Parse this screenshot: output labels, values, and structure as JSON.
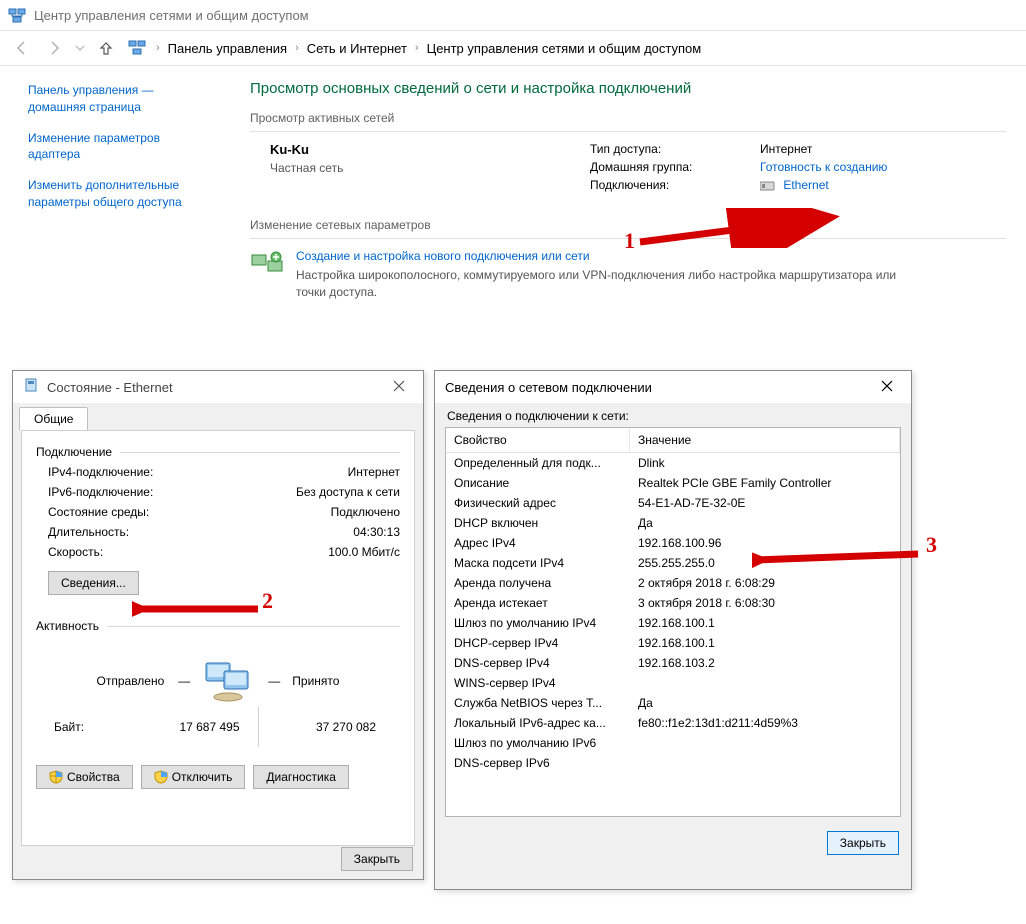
{
  "window_title": "Центр управления сетями и общим доступом",
  "breadcrumb": {
    "items": [
      "Панель управления",
      "Сеть и Интернет",
      "Центр управления сетями и общим доступом"
    ]
  },
  "left_links": [
    "Панель управления — домашняя страница",
    "Изменение параметров адаптера",
    "Изменить дополнительные параметры общего доступа"
  ],
  "page_heading": "Просмотр основных сведений о сети и настройка подключений",
  "section_active_nets": "Просмотр активных сетей",
  "net": {
    "name": "Ku-Ku",
    "type": "Частная сеть",
    "access_label": "Тип доступа:",
    "access_value": "Интернет",
    "homegroup_label": "Домашняя группа:",
    "homegroup_value": "Готовность к созданию",
    "connections_label": "Подключения:",
    "connections_value": "Ethernet"
  },
  "section_change": "Изменение сетевых параметров",
  "setup": {
    "link": "Создание и настройка нового подключения или сети",
    "desc": "Настройка широкополосного, коммутируемого или VPN-подключения либо настройка маршрутизатора или точки доступа."
  },
  "status_dialog": {
    "title": "Состояние - Ethernet",
    "tab": "Общие",
    "group_conn": "Подключение",
    "rows": [
      {
        "k": "IPv4-подключение:",
        "v": "Интернет"
      },
      {
        "k": "IPv6-подключение:",
        "v": "Без доступа к сети"
      },
      {
        "k": "Состояние среды:",
        "v": "Подключено"
      },
      {
        "k": "Длительность:",
        "v": "04:30:13"
      },
      {
        "k": "Скорость:",
        "v": "100.0 Мбит/с"
      }
    ],
    "details_btn": "Сведения...",
    "group_activity": "Активность",
    "sent_label": "Отправлено",
    "recv_label": "Принято",
    "bytes_label": "Байт:",
    "sent_bytes": "17 687 495",
    "recv_bytes": "37 270 082",
    "props_btn": "Свойства",
    "disable_btn": "Отключить",
    "diag_btn": "Диагностика",
    "close_btn": "Закрыть"
  },
  "details_dialog": {
    "title": "Сведения о сетевом подключении",
    "list_label": "Сведения о подключении к сети:",
    "col_prop": "Свойство",
    "col_val": "Значение",
    "rows": [
      {
        "k": "Определенный для подк...",
        "v": "Dlink"
      },
      {
        "k": "Описание",
        "v": "Realtek PCIe GBE Family Controller"
      },
      {
        "k": "Физический адрес",
        "v": "54-E1-AD-7E-32-0E"
      },
      {
        "k": "DHCP включен",
        "v": "Да"
      },
      {
        "k": "Адрес IPv4",
        "v": "192.168.100.96"
      },
      {
        "k": "Маска подсети IPv4",
        "v": "255.255.255.0"
      },
      {
        "k": "Аренда получена",
        "v": "2 октября 2018 г. 6:08:29"
      },
      {
        "k": "Аренда истекает",
        "v": "3 октября 2018 г. 6:08:30"
      },
      {
        "k": "Шлюз по умолчанию IPv4",
        "v": "192.168.100.1"
      },
      {
        "k": "DHCP-сервер IPv4",
        "v": "192.168.100.1"
      },
      {
        "k": "DNS-сервер IPv4",
        "v": "192.168.103.2"
      },
      {
        "k": "WINS-сервер IPv4",
        "v": ""
      },
      {
        "k": "Служба NetBIOS через T...",
        "v": "Да"
      },
      {
        "k": "Локальный IPv6-адрес ка...",
        "v": "fe80::f1e2:13d1:d211:4d59%3"
      },
      {
        "k": "Шлюз по умолчанию IPv6",
        "v": ""
      },
      {
        "k": "DNS-сервер IPv6",
        "v": ""
      }
    ],
    "close_btn": "Закрыть"
  },
  "annotations": {
    "n1": "1",
    "n2": "2",
    "n3": "3"
  }
}
